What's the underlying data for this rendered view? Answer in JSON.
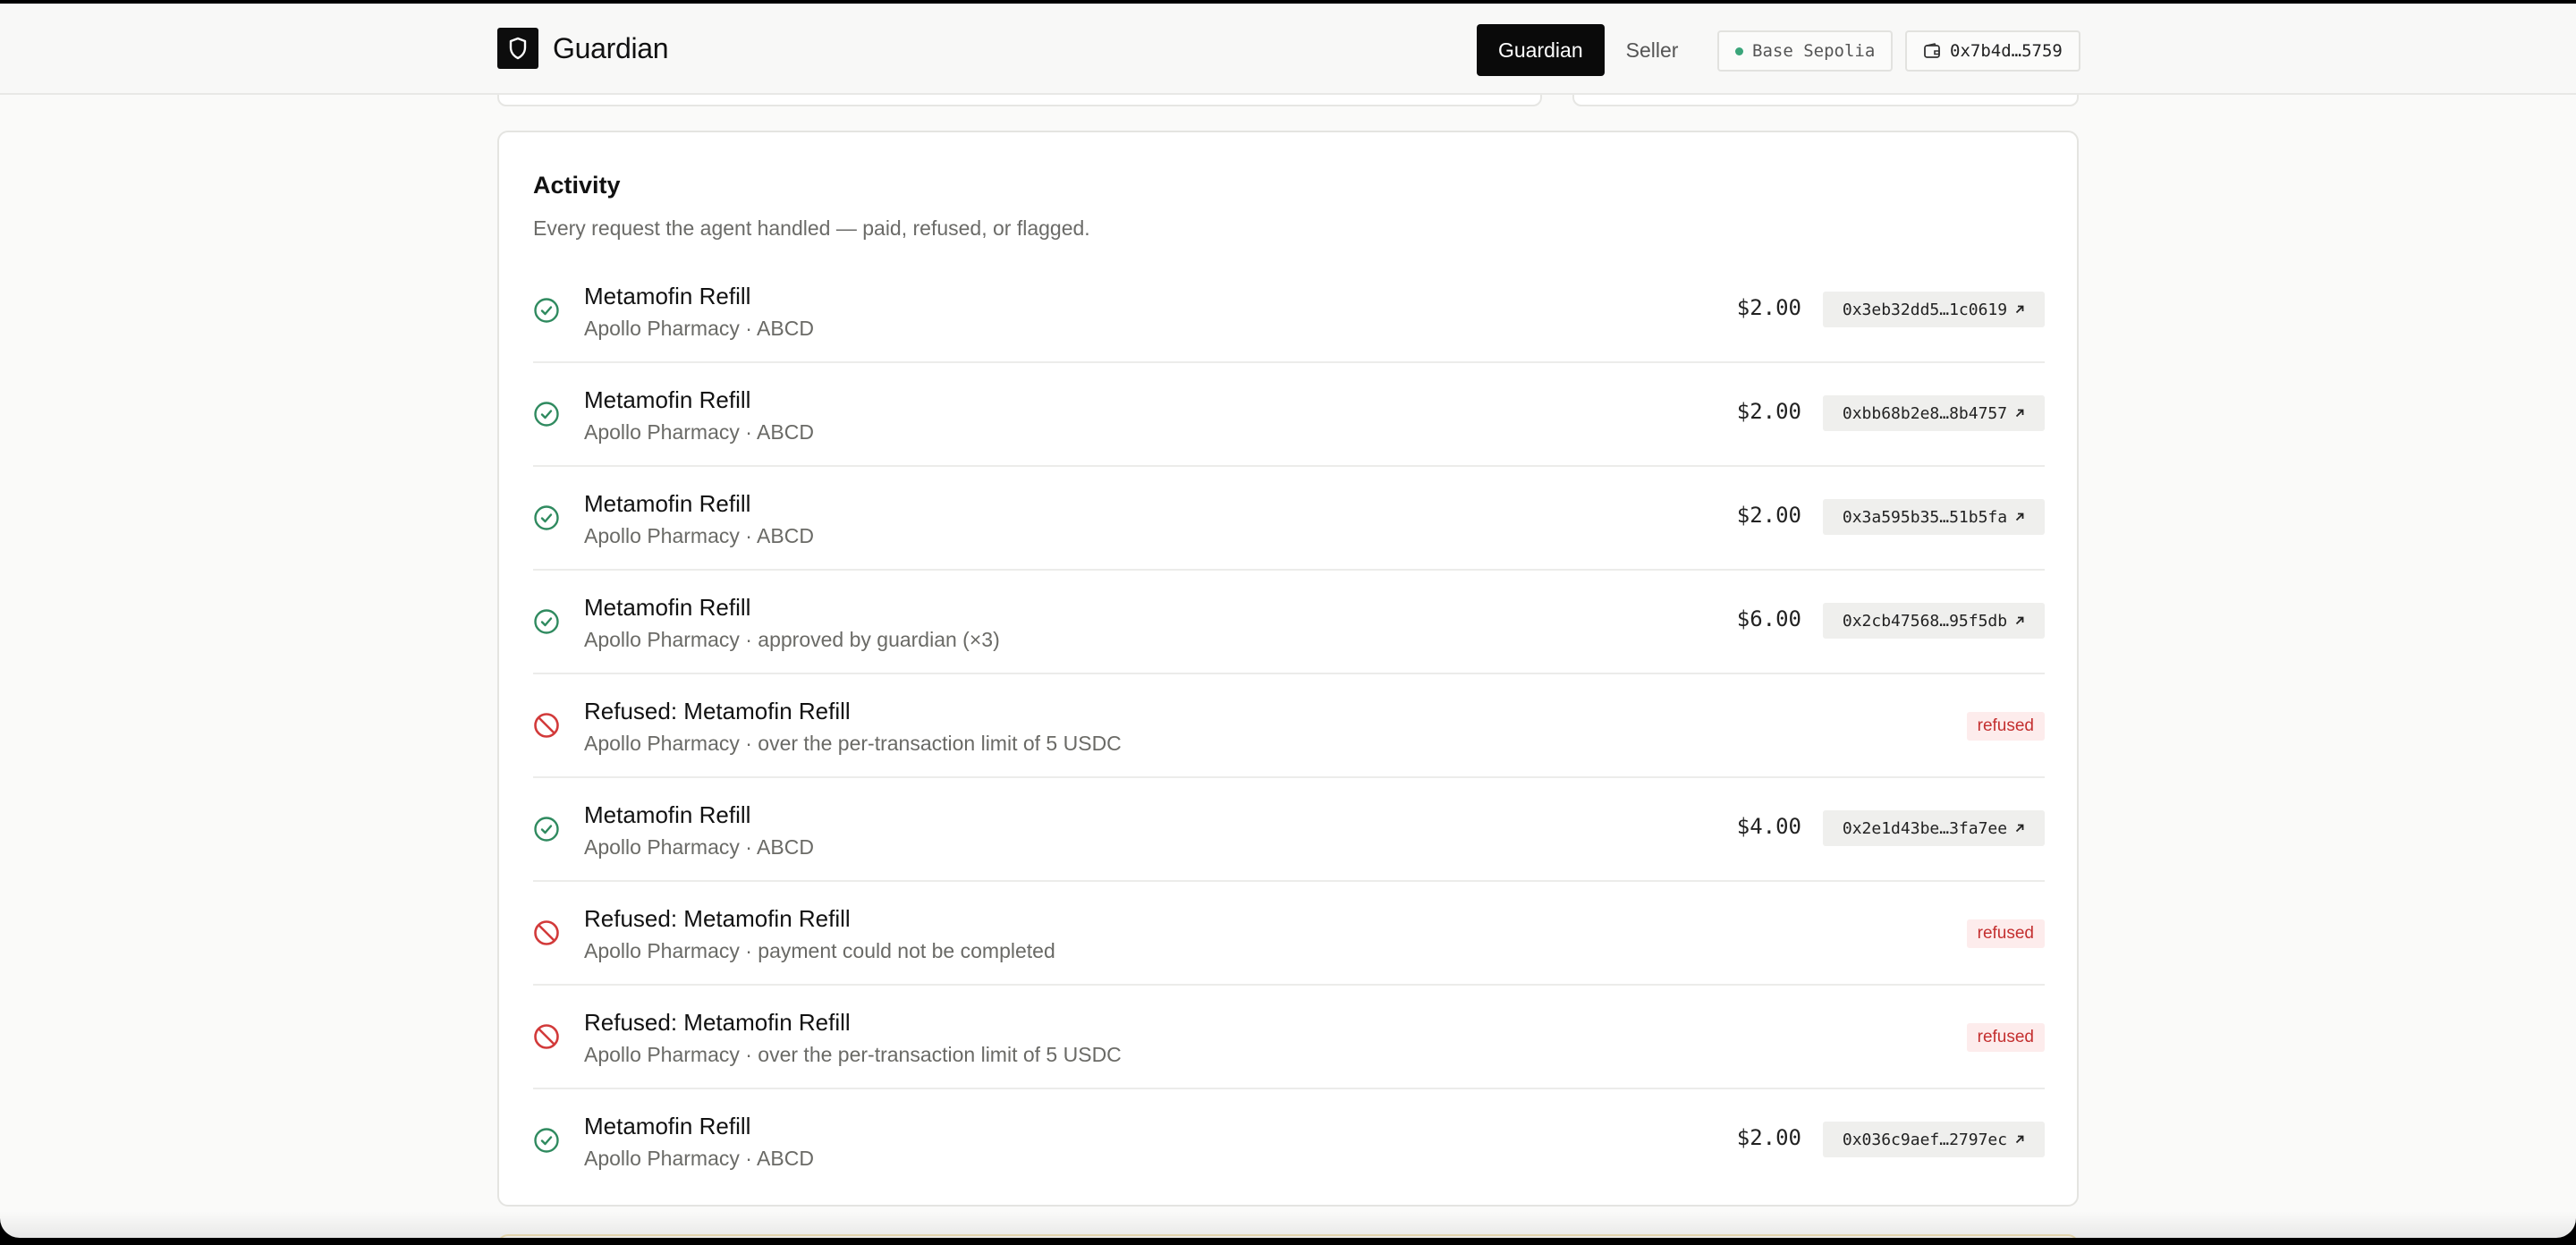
{
  "header": {
    "brand": "Guardian",
    "nav": [
      {
        "label": "Guardian",
        "active": true
      },
      {
        "label": "Seller",
        "active": false
      }
    ],
    "network": "Base Sepolia",
    "wallet": "0x7b4d…5759"
  },
  "activity": {
    "title": "Activity",
    "subtitle": "Every request the agent handled — paid, refused, or flagged.",
    "rows": [
      {
        "status": "paid",
        "title": "Metamofin Refill",
        "meta": "Apollo Pharmacy · ABCD",
        "amount": "$2.00",
        "tx": "0x3eb32dd5…1c0619"
      },
      {
        "status": "paid",
        "title": "Metamofin Refill",
        "meta": "Apollo Pharmacy · ABCD",
        "amount": "$2.00",
        "tx": "0xbb68b2e8…8b4757"
      },
      {
        "status": "paid",
        "title": "Metamofin Refill",
        "meta": "Apollo Pharmacy · ABCD",
        "amount": "$2.00",
        "tx": "0x3a595b35…51b5fa"
      },
      {
        "status": "paid",
        "title": "Metamofin Refill",
        "meta": "Apollo Pharmacy · approved by guardian (×3)",
        "amount": "$6.00",
        "tx": "0x2cb47568…95f5db"
      },
      {
        "status": "refused",
        "title": "Refused: Metamofin Refill",
        "meta": "Apollo Pharmacy · over the per-transaction limit of 5 USDC",
        "badge": "refused"
      },
      {
        "status": "paid",
        "title": "Metamofin Refill",
        "meta": "Apollo Pharmacy · ABCD",
        "amount": "$4.00",
        "tx": "0x2e1d43be…3fa7ee"
      },
      {
        "status": "refused",
        "title": "Refused: Metamofin Refill",
        "meta": "Apollo Pharmacy · payment could not be completed",
        "badge": "refused"
      },
      {
        "status": "refused",
        "title": "Refused: Metamofin Refill",
        "meta": "Apollo Pharmacy · over the per-transaction limit of 5 USDC",
        "badge": "refused"
      },
      {
        "status": "paid",
        "title": "Metamofin Refill",
        "meta": "Apollo Pharmacy · ABCD",
        "amount": "$2.00",
        "tx": "0x036c9aef…2797ec"
      }
    ]
  },
  "colors": {
    "paid": "#2f8a5f",
    "refused": "#d23a3a",
    "accent": "#0a0a0a"
  },
  "icons": {
    "brand": "shield-icon",
    "paid": "check-circle-icon",
    "refused": "ban-icon",
    "tx": "arrow-up-right-icon",
    "wallet": "wallet-icon"
  }
}
